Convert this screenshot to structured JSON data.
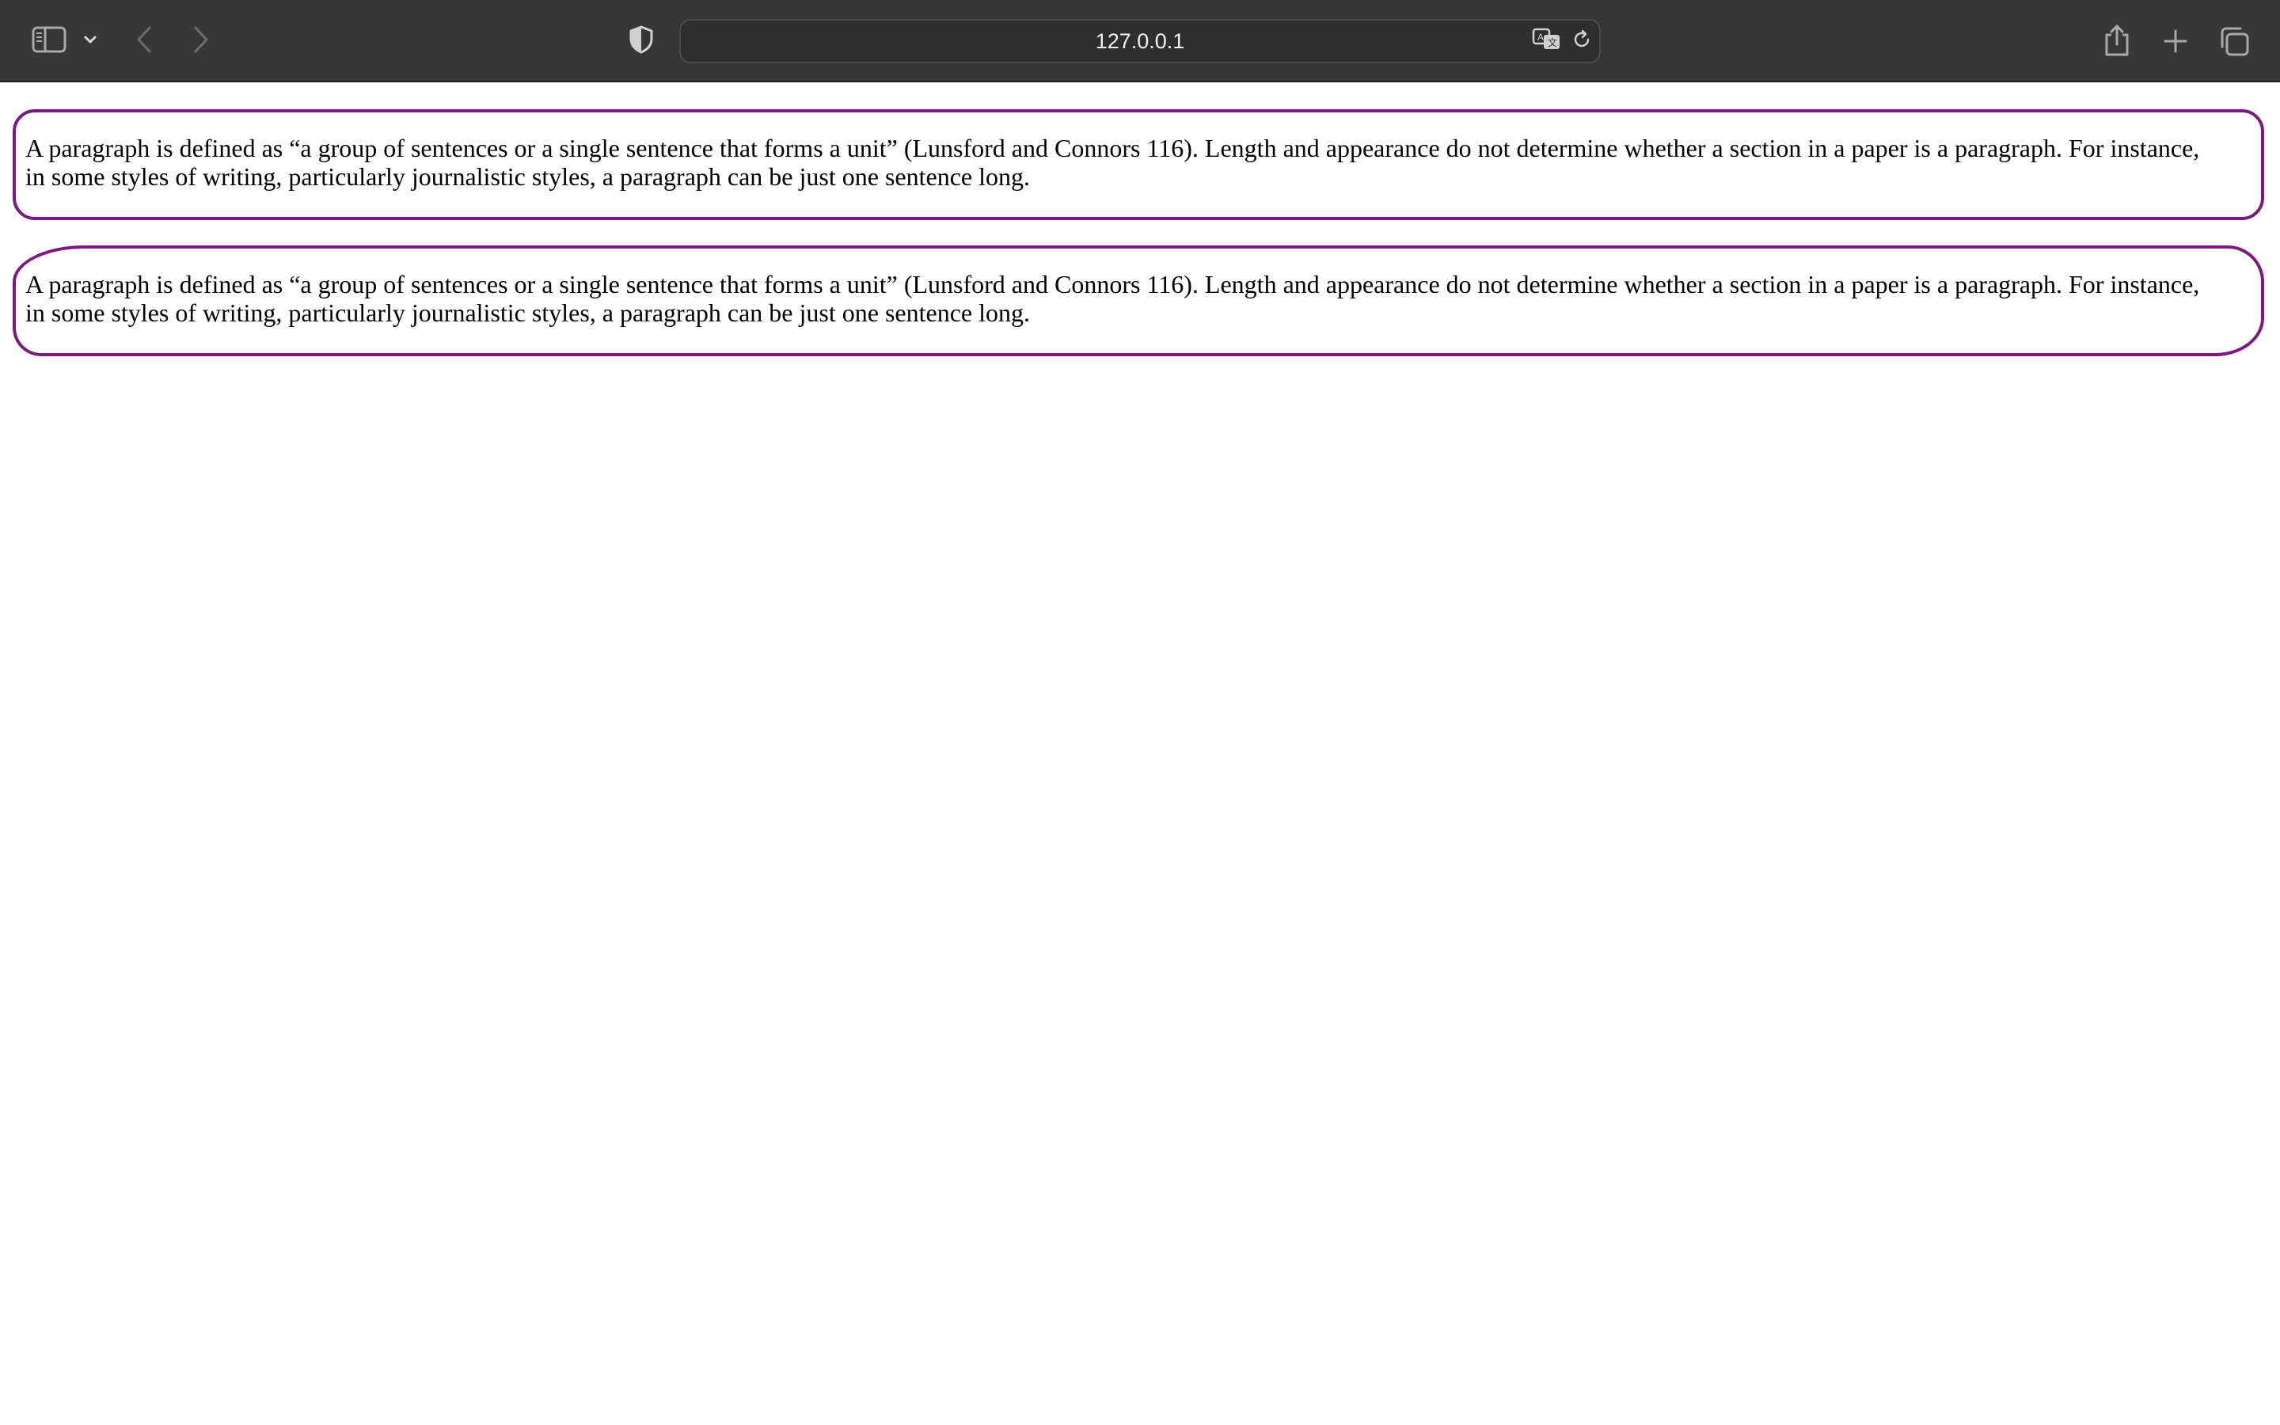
{
  "browser": {
    "address_text": "127.0.0.1",
    "icons": {
      "sidebar": "sidebar-icon",
      "sidebar_menu": "chevron-down-icon",
      "back": "chevron-left-icon",
      "forward": "chevron-right-icon",
      "privacy": "shield-icon",
      "translate": "translate-icon",
      "reload": "reload-icon",
      "share": "share-icon",
      "new_tab": "plus-icon",
      "tab_overview": "tabs-icon"
    },
    "chrome_color": "#373737"
  },
  "page": {
    "paragraphs": [
      {
        "text": "A paragraph is defined as “a group of sentences or a single sentence that forms a unit” (Lunsford and Connors 116). Length and appearance do not determine whether a section in a paper is a paragraph. For instance, in some styles of writing, particularly journalistic styles, a paragraph can be just one sentence long."
      },
      {
        "text": "A paragraph is defined as “a group of sentences or a single sentence that forms a unit” (Lunsford and Connors 116). Length and appearance do not determine whether a section in a paper is a paragraph. For instance, in some styles of writing, particularly journalistic styles, a paragraph can be just one sentence long."
      }
    ],
    "border_color": "#7b1882"
  }
}
